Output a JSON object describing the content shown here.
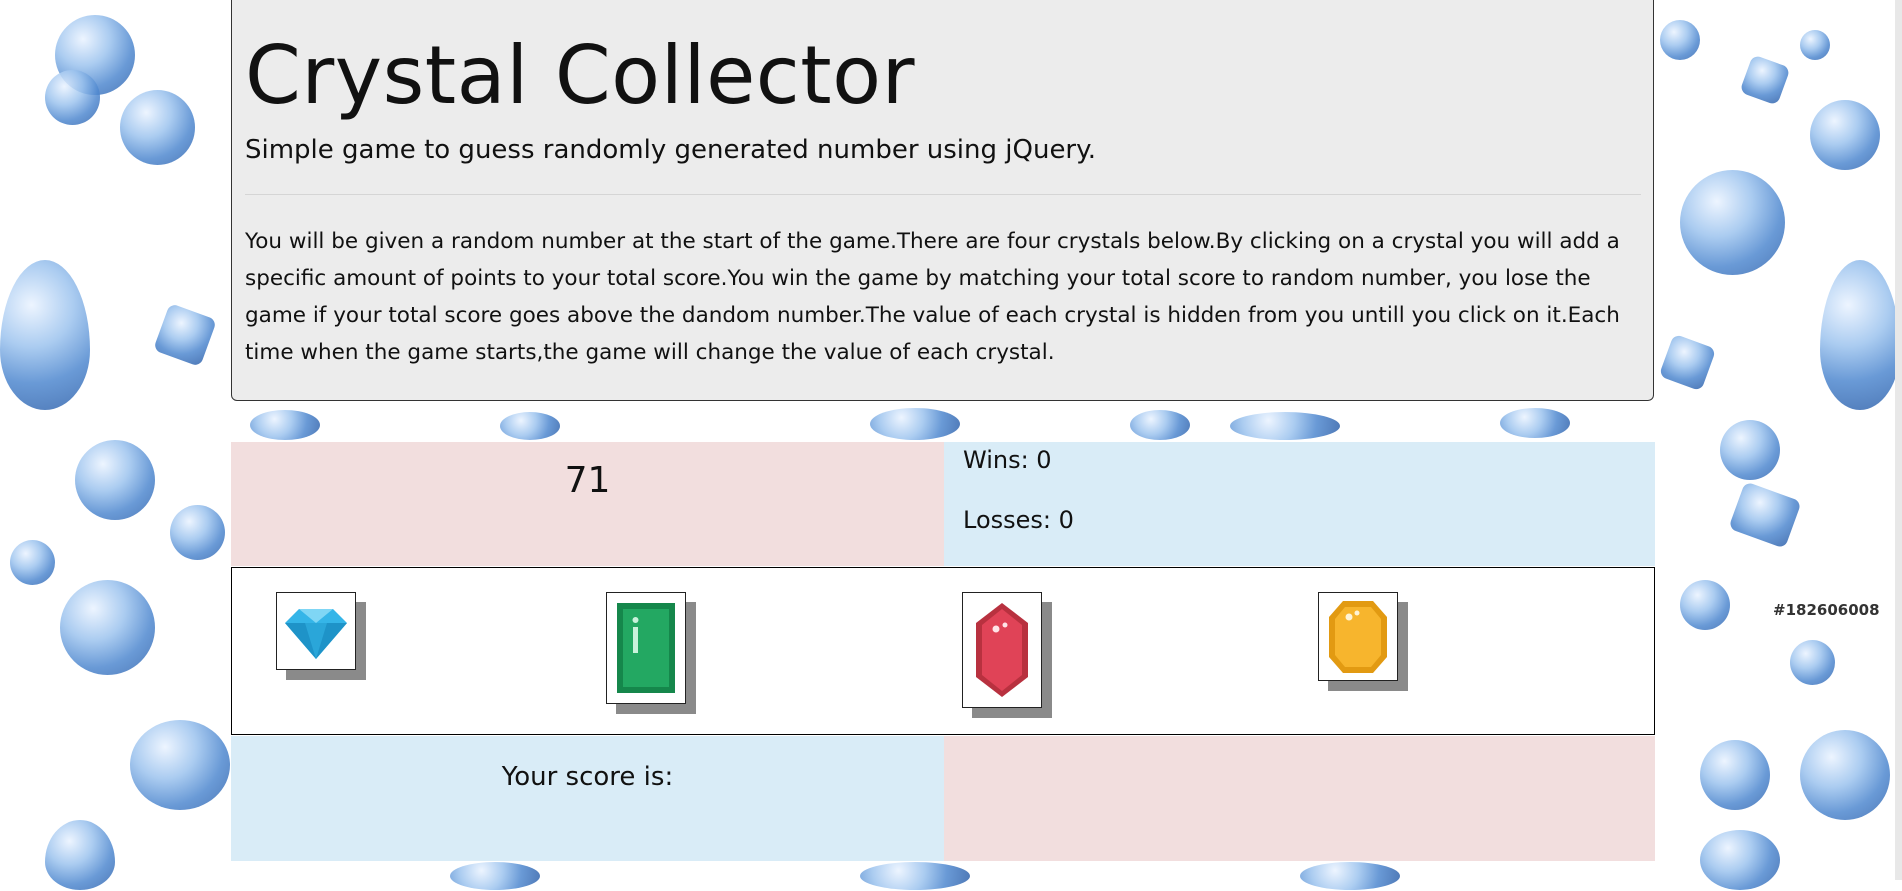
{
  "header": {
    "title": "Crystal Collector",
    "subtitle": "Simple game to guess randomly generated number using jQuery.",
    "description": "You will be given a random number at the start of the game.There are four crystals below.By clicking on a crystal you will add a specific amount of points to your total score.You win the game by matching your total score to random number, you lose the game if your total score goes above the dandom number.The value of each crystal is hidden from you untill you click on it.Each time when the game starts,the game will change the value of each crystal."
  },
  "game": {
    "target_number": "71",
    "wins_text": "Wins: 0",
    "losses_text": "Losses: 0",
    "score_label": "Your score is:",
    "score_value": ""
  },
  "crystals": [
    {
      "icon": "blue-diamond-icon",
      "color": "#2aa6d9"
    },
    {
      "icon": "green-emerald-icon",
      "color": "#1fa05a"
    },
    {
      "icon": "red-ruby-icon",
      "color": "#e04357"
    },
    {
      "icon": "yellow-topaz-icon",
      "color": "#f7b52d"
    }
  ],
  "colors": {
    "panel_bg": "#ececec",
    "pink_cell": "#f2dede",
    "blue_cell": "#d9ecf7"
  },
  "watermark": "#182606008"
}
